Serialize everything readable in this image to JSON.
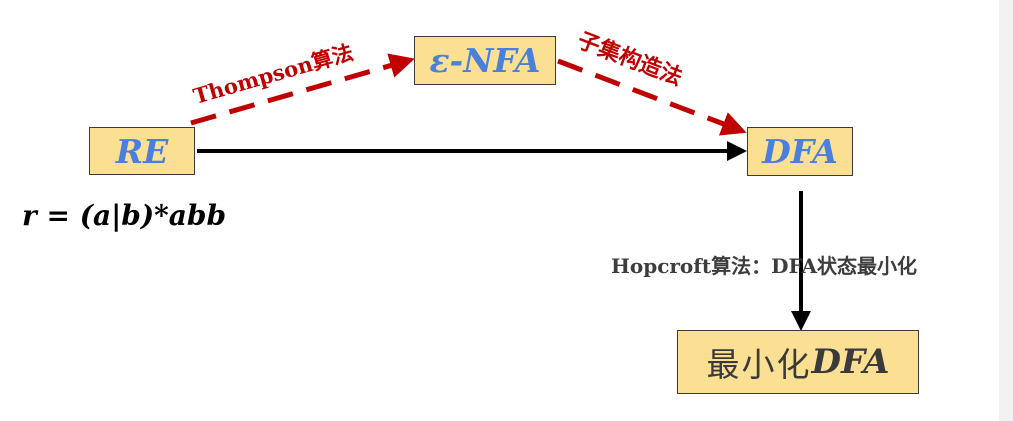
{
  "nodes": {
    "re": "RE",
    "enfa": "ε-NFA",
    "dfa": "DFA",
    "min_dfa": {
      "cn": "最小化",
      "en": "DFA"
    }
  },
  "regex": "r = (a|b)*abb",
  "edges": {
    "thompson": "Thompson算法",
    "subset": "子集构造法",
    "hopcroft": "Hopcroft算法：DFA状态最小化"
  },
  "colors": {
    "box_fill": "#fbdf93",
    "node_text": "#4a7fdc",
    "dashed_arrow": "#c00000",
    "solid_arrow": "#000000"
  }
}
